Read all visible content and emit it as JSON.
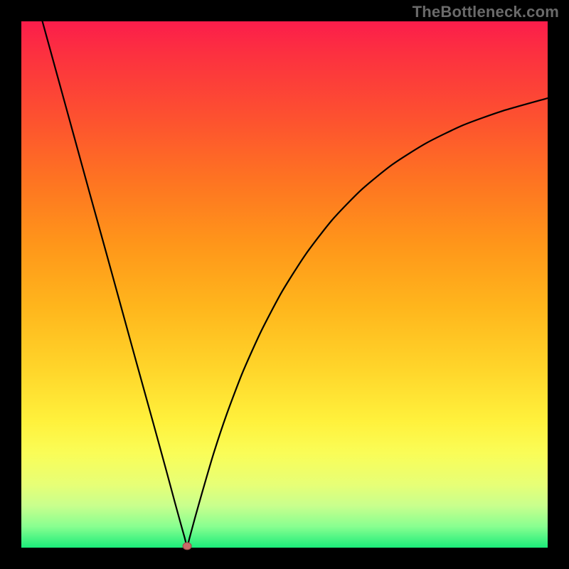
{
  "watermark": "TheBottleneck.com",
  "chart_data": {
    "type": "line",
    "title": "",
    "xlabel": "",
    "ylabel": "",
    "xlim": [
      0,
      1
    ],
    "ylim": [
      0,
      1
    ],
    "marker": {
      "x": 0.315,
      "y": 0.003
    },
    "note": "Axes omitted in source; x and y are normalized 0–1. Curve is a V / checkmark shape with minimum near x≈0.315, left branch near-straight from top-left, right branch decelerating toward ~0.85 at x=1.",
    "curve_points": [
      {
        "x": 0.04,
        "y": 1.0
      },
      {
        "x": 0.07,
        "y": 0.891
      },
      {
        "x": 0.1,
        "y": 0.782
      },
      {
        "x": 0.13,
        "y": 0.673
      },
      {
        "x": 0.16,
        "y": 0.565
      },
      {
        "x": 0.19,
        "y": 0.456
      },
      {
        "x": 0.22,
        "y": 0.347
      },
      {
        "x": 0.25,
        "y": 0.239
      },
      {
        "x": 0.275,
        "y": 0.148
      },
      {
        "x": 0.292,
        "y": 0.085
      },
      {
        "x": 0.303,
        "y": 0.045
      },
      {
        "x": 0.31,
        "y": 0.02
      },
      {
        "x": 0.315,
        "y": 0.003
      },
      {
        "x": 0.32,
        "y": 0.02
      },
      {
        "x": 0.33,
        "y": 0.057
      },
      {
        "x": 0.345,
        "y": 0.11
      },
      {
        "x": 0.365,
        "y": 0.178
      },
      {
        "x": 0.39,
        "y": 0.253
      },
      {
        "x": 0.42,
        "y": 0.332
      },
      {
        "x": 0.455,
        "y": 0.41
      },
      {
        "x": 0.495,
        "y": 0.486
      },
      {
        "x": 0.54,
        "y": 0.557
      },
      {
        "x": 0.59,
        "y": 0.622
      },
      {
        "x": 0.645,
        "y": 0.679
      },
      {
        "x": 0.705,
        "y": 0.728
      },
      {
        "x": 0.77,
        "y": 0.769
      },
      {
        "x": 0.84,
        "y": 0.803
      },
      {
        "x": 0.915,
        "y": 0.83
      },
      {
        "x": 1.0,
        "y": 0.854
      }
    ],
    "gradient_colors": {
      "top": "#fb1d4b",
      "mid": "#ffd52a",
      "bottom": "#1bec7a"
    }
  }
}
